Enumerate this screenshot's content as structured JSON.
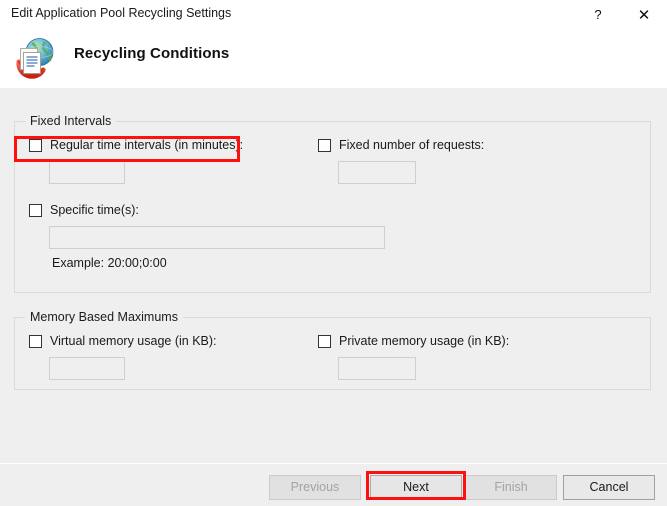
{
  "window": {
    "title": "Edit Application Pool Recycling Settings",
    "help_label": "?",
    "close_label": "✕"
  },
  "header": {
    "title": "Recycling Conditions",
    "icon": "recycling-globe-document-icon"
  },
  "groups": [
    {
      "id": "fixed-intervals",
      "legend": "Fixed Intervals",
      "rows": [
        {
          "id": "regular-time-intervals",
          "label": "Regular time intervals (in minutes):",
          "checked": false,
          "value": "",
          "highlighted": true
        },
        {
          "id": "fixed-number-of-requests",
          "label": "Fixed number of requests:",
          "checked": false,
          "value": "",
          "highlighted": false
        },
        {
          "id": "specific-times",
          "label": "Specific time(s):",
          "checked": false,
          "value": "",
          "highlighted": false
        }
      ],
      "example": "Example: 20:00;0:00"
    },
    {
      "id": "memory-based-maximums",
      "legend": "Memory Based Maximums",
      "rows": [
        {
          "id": "virtual-memory-usage",
          "label": "Virtual memory usage (in KB):",
          "checked": false,
          "value": "",
          "highlighted": false
        },
        {
          "id": "private-memory-usage",
          "label": "Private memory usage (in KB):",
          "checked": false,
          "value": "",
          "highlighted": false
        }
      ]
    }
  ],
  "footer": {
    "previous_label": "Previous",
    "next_label": "Next",
    "finish_label": "Finish",
    "cancel_label": "Cancel",
    "previous_enabled": false,
    "next_enabled": true,
    "finish_enabled": false,
    "cancel_enabled": true
  },
  "annotations": {
    "highlight_color": "#ff1010",
    "targets": [
      "regular-time-intervals-checkbox",
      "next-button"
    ]
  }
}
